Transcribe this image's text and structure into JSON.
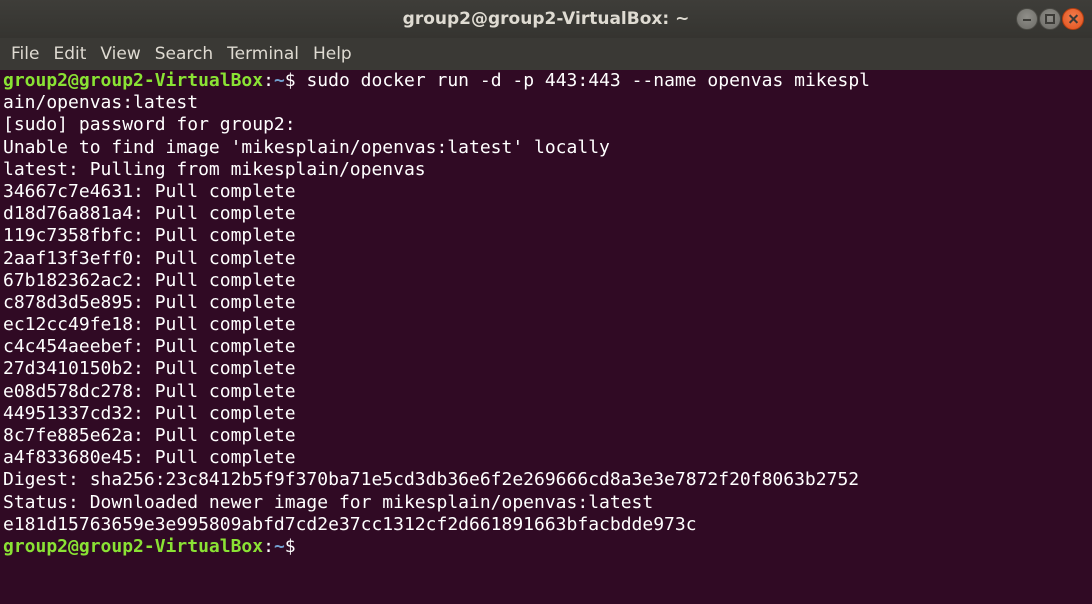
{
  "window": {
    "title": "group2@group2-VirtualBox: ~"
  },
  "menu": {
    "items": [
      "File",
      "Edit",
      "View",
      "Search",
      "Terminal",
      "Help"
    ]
  },
  "prompt": {
    "user_host": "group2@group2-VirtualBox",
    "colon": ":",
    "path": "~",
    "symbol": "$ "
  },
  "command": {
    "text": "sudo docker run -d -p 443:443 --name openvas mikespl",
    "wrap": "ain/openvas:latest"
  },
  "output": [
    "[sudo] password for group2:",
    "Unable to find image 'mikesplain/openvas:latest' locally",
    "latest: Pulling from mikesplain/openvas",
    "34667c7e4631: Pull complete",
    "d18d76a881a4: Pull complete",
    "119c7358fbfc: Pull complete",
    "2aaf13f3eff0: Pull complete",
    "67b182362ac2: Pull complete",
    "c878d3d5e895: Pull complete",
    "ec12cc49fe18: Pull complete",
    "c4c454aeebef: Pull complete",
    "27d3410150b2: Pull complete",
    "e08d578dc278: Pull complete",
    "44951337cd32: Pull complete",
    "8c7fe885e62a: Pull complete",
    "a4f833680e45: Pull complete",
    "Digest: sha256:23c8412b5f9f370ba71e5cd3db36e6f2e269666cd8a3e3e7872f20f8063b2752",
    "Status: Downloaded newer image for mikesplain/openvas:latest",
    "e181d15763659e3e995809abfd7cd2e37cc1312cf2d661891663bfacbdde973c"
  ],
  "colors": {
    "background": "#300a24",
    "prompt_user": "#8ae234",
    "prompt_path": "#729fcf",
    "close_button": "#e95420"
  }
}
